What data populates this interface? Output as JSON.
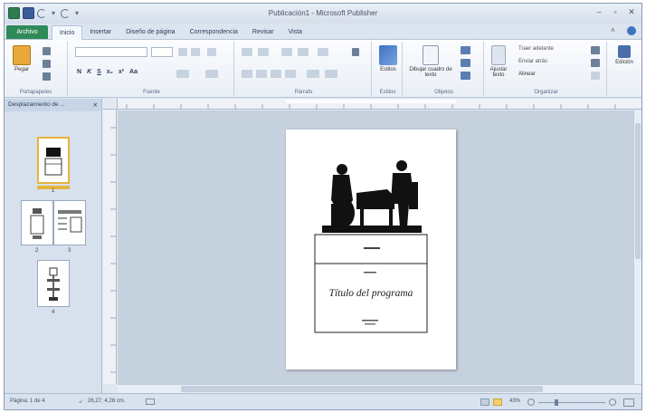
{
  "window": {
    "title": "Publicación1 - Microsoft Publisher"
  },
  "tabs": {
    "file": "Archivo",
    "items": [
      "Inicio",
      "Insertar",
      "Diseño de página",
      "Correspondencia",
      "Revisar",
      "Vista"
    ],
    "active": "Inicio"
  },
  "ribbon": {
    "groups": {
      "clipboard": "Portapapeles",
      "font": "Fuente",
      "paragraph": "Párrafo",
      "styles": "Estilos",
      "objects": "Objetos",
      "arrange": "Organizar"
    },
    "buttons": {
      "paste": "Pegar",
      "styles": "Estilos",
      "draw_textbox": "Dibujar cuadro de texto",
      "wrap_text": "Ajustar texto",
      "bring_forward": "Traer adelante",
      "send_backward": "Enviar atrás",
      "align": "Alinear",
      "editing": "Edición"
    },
    "font_styles": [
      "N",
      "K",
      "S",
      "x₂",
      "x²",
      "Aa"
    ]
  },
  "nav_pane": {
    "title": "Desplazamiento de ...",
    "pages": [
      "1",
      "2",
      "3",
      "4"
    ]
  },
  "document": {
    "title": "Título del programa"
  },
  "status": {
    "page": "Página: 1 de 4",
    "position": "26,27; 4,28 cm.",
    "zoom": "43%"
  },
  "colors": {
    "file_tab": "#2e8b57",
    "selection": "#e4b43c"
  }
}
